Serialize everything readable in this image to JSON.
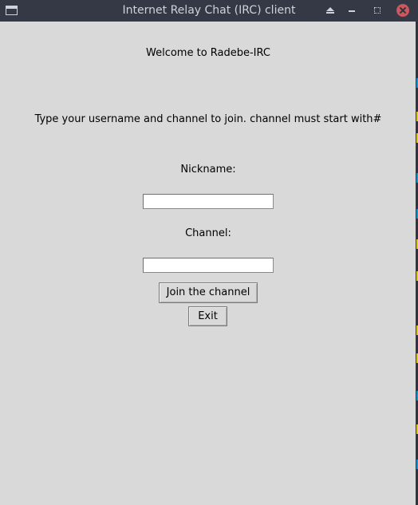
{
  "window": {
    "title": "Internet Relay Chat (IRC) client"
  },
  "titlebar": {
    "buttons": [
      "shade",
      "minimize",
      "maximize",
      "close"
    ],
    "close_color": "#cc575d"
  },
  "main": {
    "welcome": "Welcome to Radebe-IRC",
    "instructions": "Type your username and channel to join. channel must start with#",
    "nickname_label": "Nickname:",
    "nickname_value": "",
    "channel_label": "Channel:",
    "channel_value": "",
    "join_button": "Join the channel",
    "exit_button": "Exit"
  },
  "colors": {
    "background": "#d9d9d9",
    "titlebar": "#353945",
    "title_text": "#cfd2d8"
  }
}
